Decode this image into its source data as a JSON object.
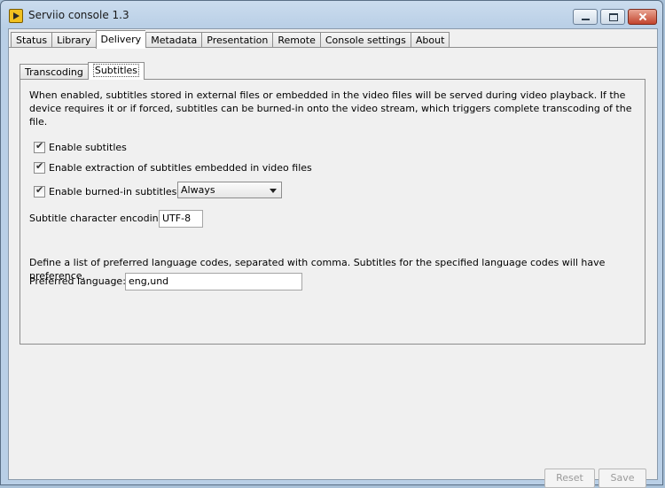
{
  "window": {
    "title": "Serviio console 1.3"
  },
  "main_tabs": [
    {
      "label": "Status"
    },
    {
      "label": "Library"
    },
    {
      "label": "Delivery",
      "active": true
    },
    {
      "label": "Metadata"
    },
    {
      "label": "Presentation"
    },
    {
      "label": "Remote"
    },
    {
      "label": "Console settings"
    },
    {
      "label": "About"
    }
  ],
  "sub_tabs": [
    {
      "label": "Transcoding"
    },
    {
      "label": "Subtitles",
      "active": true
    }
  ],
  "subtitles": {
    "description": "When enabled, subtitles stored in external files or embedded in the video files will be served during video playback. If the device requires it or if forced, subtitles can be burned-in onto the video stream, which triggers complete transcoding of the file.",
    "enable_subtitles": {
      "label": "Enable subtitles",
      "checked": true
    },
    "enable_extraction": {
      "label": "Enable extraction of subtitles embedded in video files",
      "checked": true
    },
    "enable_burned_in": {
      "label": "Enable burned-in subtitles",
      "checked": true,
      "selected": "Always"
    },
    "encoding": {
      "label": "Subtitle character encoding:",
      "value": "UTF-8"
    },
    "language_description": "Define a list of preferred language codes, separated with comma. Subtitles for the specified language codes will have preference.",
    "preferred_language": {
      "label": "Preferred language:",
      "value": "eng,und"
    }
  },
  "buttons": {
    "reset": "Reset",
    "save": "Save"
  }
}
